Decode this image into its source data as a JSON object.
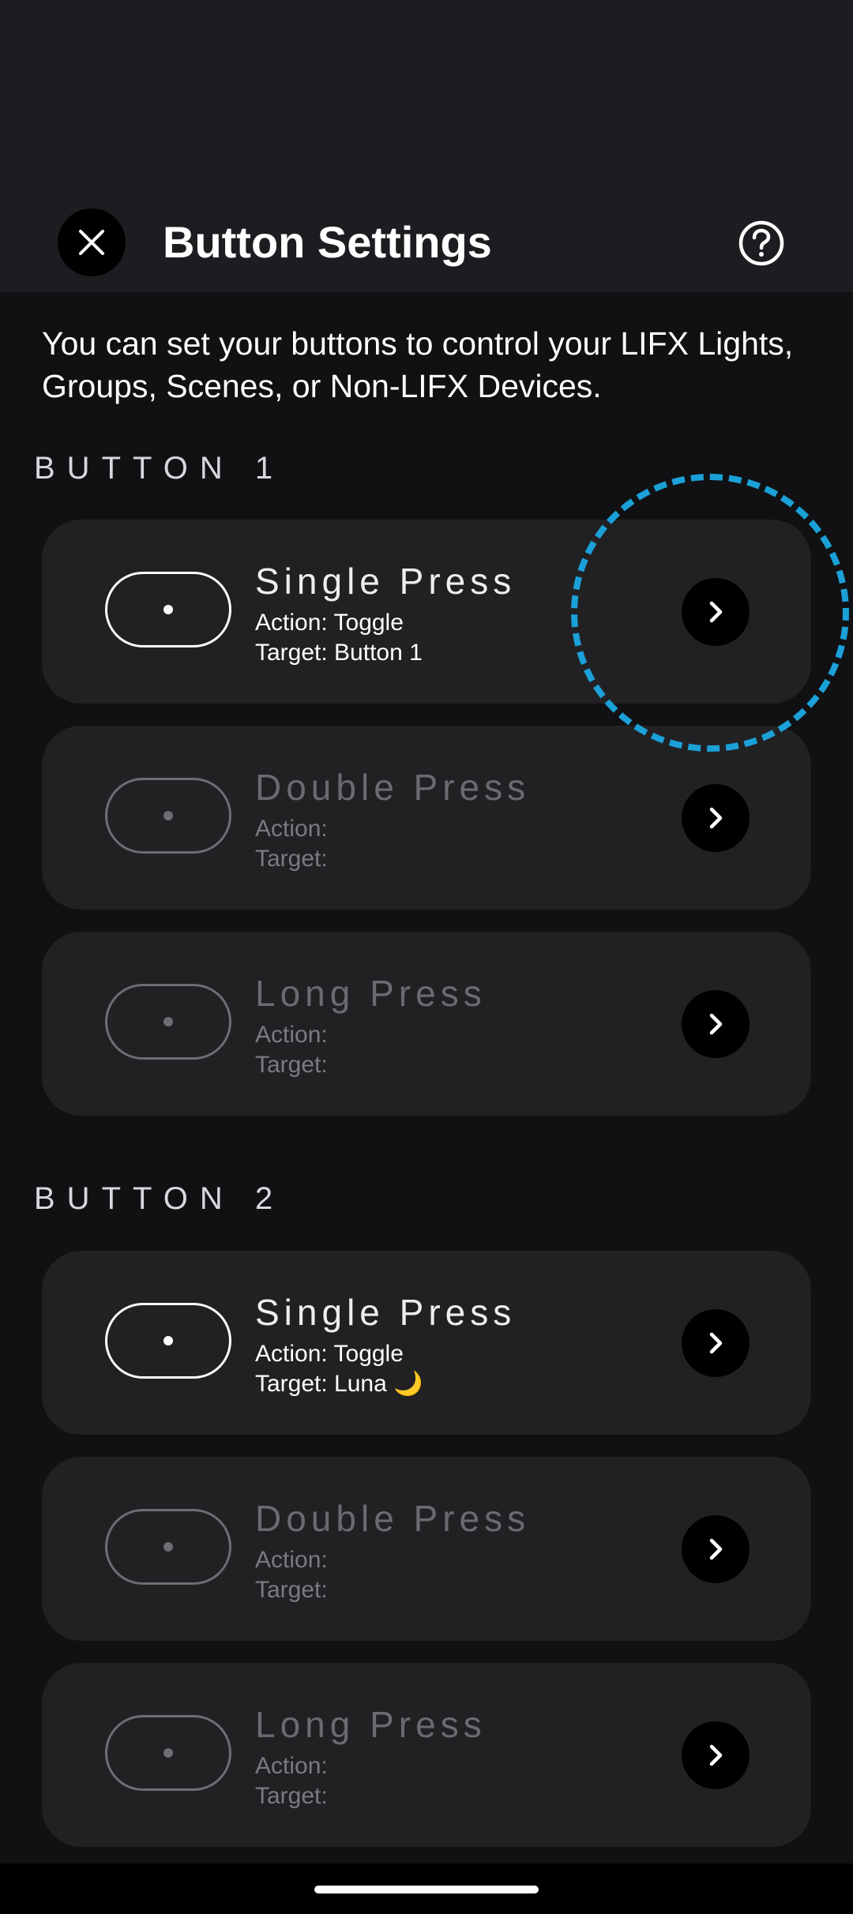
{
  "header": {
    "title": "Button Settings",
    "close_icon": "close-icon",
    "help_icon": "help-circle-icon"
  },
  "intro": "You can set your buttons to control your LIFX Lights, Groups, Scenes, or Non-LIFX Devices.",
  "sections": [
    {
      "title": "BUTTON 1",
      "cards": [
        {
          "title": "Single Press",
          "action": "Action: Toggle",
          "target": "Target: Button 1",
          "state": "configured"
        },
        {
          "title": "Double Press",
          "action": "Action:",
          "target": "Target:",
          "state": "empty"
        },
        {
          "title": "Long Press",
          "action": "Action:",
          "target": "Target:",
          "state": "empty"
        }
      ]
    },
    {
      "title": "BUTTON 2",
      "cards": [
        {
          "title": "Single Press",
          "action": "Action: Toggle",
          "target": "Target: Luna 🌙",
          "state": "configured"
        },
        {
          "title": "Double Press",
          "action": "Action:",
          "target": "Target:",
          "state": "empty"
        },
        {
          "title": "Long Press",
          "action": "Action:",
          "target": "Target:",
          "state": "empty"
        }
      ]
    }
  ],
  "colors": {
    "background": "#111114",
    "header_bg": "#1d1d21",
    "card_bg": "#212124",
    "highlight": "#1ba0d8"
  },
  "icons": {
    "chevron": "chevron-right-icon",
    "pill": "button-pill-icon"
  }
}
